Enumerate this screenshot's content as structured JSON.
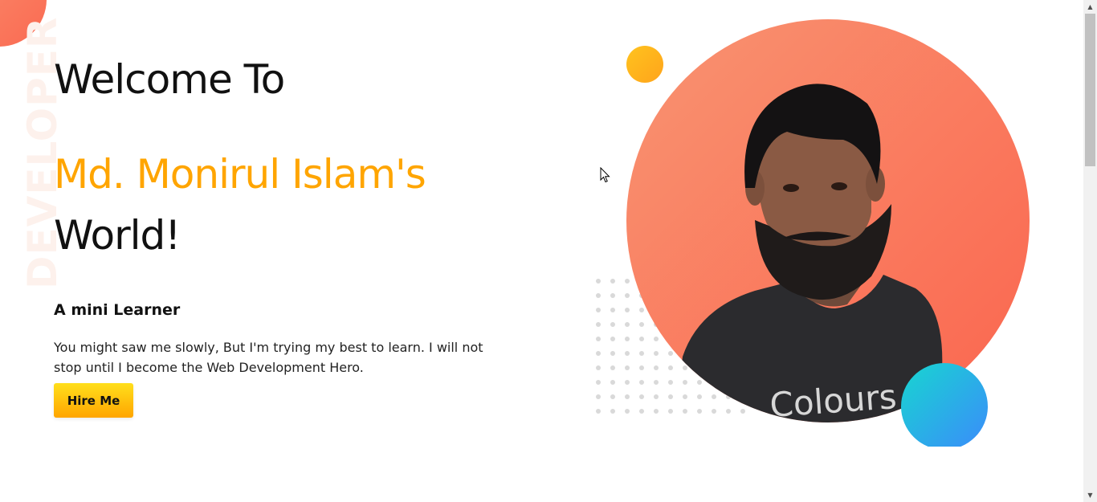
{
  "decor": {
    "vertical_word": "DEVELOPER"
  },
  "hero": {
    "welcome": "Welcome To",
    "name": "Md. Monirul Islam's",
    "world": "World!",
    "subtitle": "A mini Learner",
    "description": "You might saw me slowly, But I'm trying my best to learn. I will not stop until I become the Web Development Hero.",
    "button_label": "Hire Me"
  },
  "portrait": {
    "shirt_text": "Colours"
  },
  "colors": {
    "accent_name": "#ffa500",
    "main_circle": "#fa6a52",
    "button_gradient_top": "#ffdf1c",
    "button_gradient_bottom": "#ffa500",
    "small_orange": "#ffb31d",
    "small_blue": "#2cb3e6"
  },
  "scrollbar": {
    "up_icon": "scroll-up-arrow-icon",
    "down_icon": "scroll-down-arrow-icon"
  }
}
